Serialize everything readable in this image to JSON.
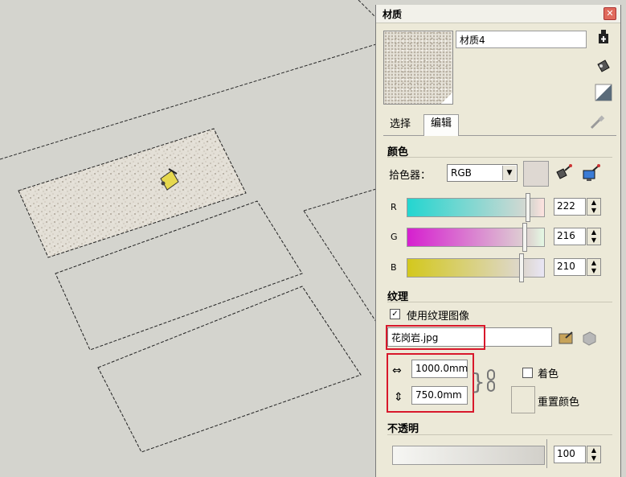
{
  "panel": {
    "title": "材质",
    "material_name": "材质4",
    "tabs": [
      "选择",
      "编辑"
    ],
    "active_tab": "编辑",
    "icons": {
      "close": "close-icon",
      "create": "create-material-icon",
      "paint": "paint-bucket-icon",
      "default": "default-material-icon",
      "eyedropper": "eyedropper-icon"
    }
  },
  "color": {
    "section_title": "颜色",
    "picker_label": "拾色器：",
    "picker_value": "RGB",
    "r_label": "R",
    "g_label": "G",
    "b_label": "B",
    "r_value": "222",
    "g_value": "216",
    "b_value": "210",
    "preview_color": "#ded8d2"
  },
  "texture": {
    "section_title": "纹理",
    "use_texture_label": "使用纹理图像",
    "use_texture_checked": true,
    "filename": "花岗岩.jpg",
    "width": "1000.0mm",
    "height": "750.0mm",
    "colorize_label": "着色",
    "reset_color_label": "重置颜色"
  },
  "opacity": {
    "section_title": "不透明",
    "value": "100"
  }
}
